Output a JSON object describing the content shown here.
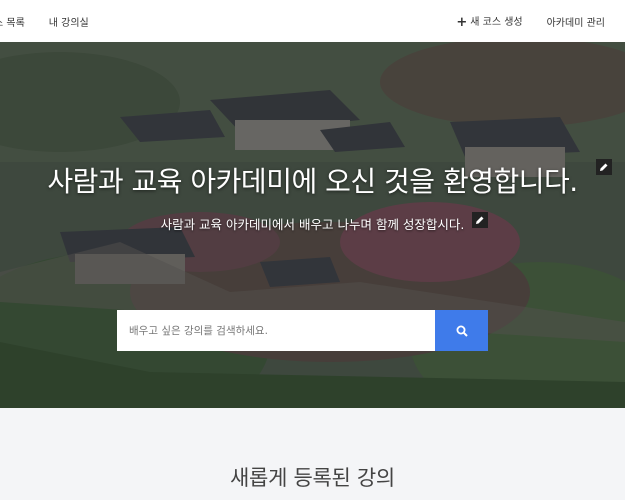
{
  "nav": {
    "left": [
      "스 목록",
      "내 강의실"
    ],
    "right": {
      "new_course": "새 코스 생성",
      "admin": "아카데미 관리"
    }
  },
  "hero": {
    "title": "사람과 교육 아카데미에 오신 것을 환영합니다.",
    "subtitle": "사람과 교육 아카데미에서 배우고 나누며 함께 성장합시다.",
    "search_placeholder": "배우고 싶은 강의를 검색하세요.",
    "search_value": ""
  },
  "colors": {
    "accent": "#3f7bea"
  },
  "section": {
    "title": "새롭게 등록된 강의"
  }
}
